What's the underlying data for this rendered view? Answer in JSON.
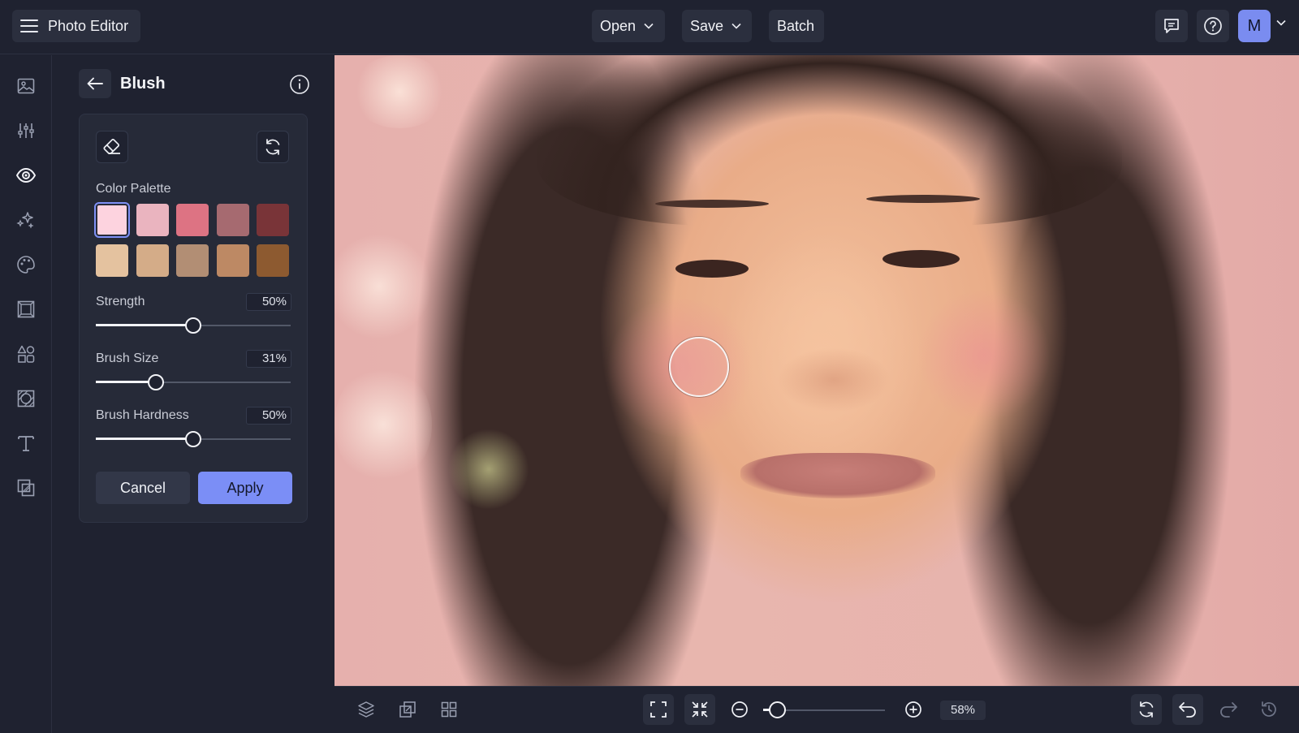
{
  "app": {
    "title": "Photo Editor",
    "menu_icon": "hamburger-icon"
  },
  "toolbar": {
    "open_label": "Open",
    "save_label": "Save",
    "batch_label": "Batch",
    "avatar_initial": "M",
    "accent_color": "#7b8ef6"
  },
  "rail": {
    "items": [
      {
        "name": "image-icon"
      },
      {
        "name": "adjust-sliders-icon"
      },
      {
        "name": "eye-icon",
        "active": true
      },
      {
        "name": "sparkles-icon"
      },
      {
        "name": "palette-icon"
      },
      {
        "name": "frame-icon"
      },
      {
        "name": "shapes-icon"
      },
      {
        "name": "texture-icon"
      },
      {
        "name": "text-icon"
      },
      {
        "name": "overlay-icon"
      }
    ]
  },
  "panel": {
    "title": "Blush",
    "palette_label": "Color Palette",
    "swatches": [
      "#fdd3df",
      "#eab4bf",
      "#dd7383",
      "#a66a70",
      "#793438",
      "#e4c29f",
      "#d4ac88",
      "#b28e74",
      "#bd8964",
      "#8d5a30"
    ],
    "selected_swatch": 0,
    "strength": {
      "label": "Strength",
      "value_text": "50%",
      "value": 50
    },
    "brush_size": {
      "label": "Brush Size",
      "value_text": "31%",
      "value": 31
    },
    "brush_hardness": {
      "label": "Brush Hardness",
      "value_text": "50%",
      "value": 50
    },
    "cancel_label": "Cancel",
    "apply_label": "Apply"
  },
  "bottom": {
    "zoom_text": "58%",
    "zoom_value": 58
  }
}
